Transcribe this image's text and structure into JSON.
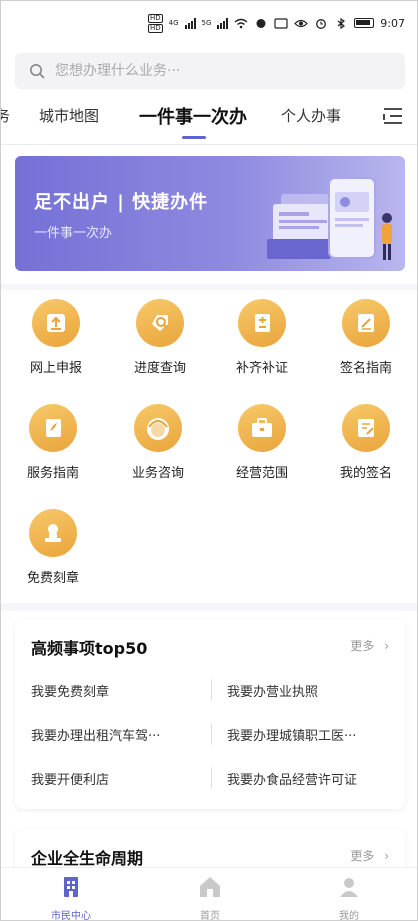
{
  "status_bar": {
    "sim1": "HD",
    "sim2": "HD",
    "net1": "4G",
    "net2": "5G",
    "time": "9:07"
  },
  "search": {
    "placeholder": "您想办理什么业务···"
  },
  "tabs": [
    {
      "label": "务",
      "active": false
    },
    {
      "label": "城市地图",
      "active": false
    },
    {
      "label": "一件事一次办",
      "active": true
    },
    {
      "label": "个人办事",
      "active": false
    }
  ],
  "banner": {
    "title": "足不出户 | 快捷办件",
    "subtitle": "一件事一次办"
  },
  "services": [
    {
      "label": "网上申报",
      "icon": "upload-icon"
    },
    {
      "label": "进度查询",
      "icon": "progress-search-icon"
    },
    {
      "label": "补齐补证",
      "icon": "supplement-doc-icon"
    },
    {
      "label": "签名指南",
      "icon": "sign-guide-icon"
    },
    {
      "label": "服务指南",
      "icon": "guide-book-icon"
    },
    {
      "label": "业务咨询",
      "icon": "consult-icon"
    },
    {
      "label": "经营范围",
      "icon": "briefcase-icon"
    },
    {
      "label": "我的签名",
      "icon": "my-signature-icon"
    },
    {
      "label": "免费刻章",
      "icon": "seal-stamp-icon"
    }
  ],
  "top50": {
    "title": "高频事项top50",
    "more": "更多",
    "items": [
      "我要免费刻章",
      "我要办营业执照",
      "我要办理出租汽车驾···",
      "我要办理城镇职工医···",
      "我要开便利店",
      "我要办食品经营许可证"
    ]
  },
  "lifecycle": {
    "title": "企业全生命周期",
    "more": "更多"
  },
  "bottom_nav": [
    {
      "label": "市民中心",
      "icon": "citizen-center-icon",
      "active": true
    },
    {
      "label": "首页",
      "icon": "home-icon",
      "active": false
    },
    {
      "label": "我的",
      "icon": "profile-icon",
      "active": false
    }
  ],
  "colors": {
    "accent": "#5e64c9",
    "icon_gold": "#e9a43a",
    "banner": "#7570d6"
  }
}
